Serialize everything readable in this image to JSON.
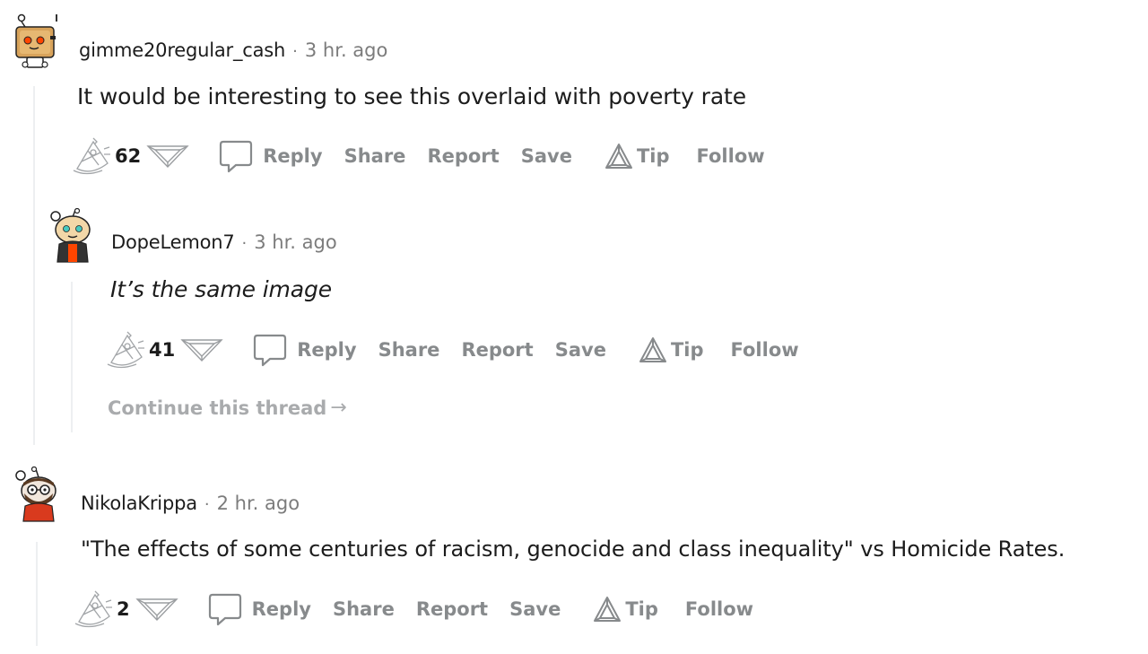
{
  "comments": [
    {
      "username": "gimme20regular_cash",
      "separator": "·",
      "time": "3 hr. ago",
      "body": "It would be interesting to see this overlaid with poverty rate",
      "score": "62",
      "actions": {
        "reply": "Reply",
        "share": "Share",
        "report": "Report",
        "save": "Save",
        "tip": "Tip",
        "follow": "Follow"
      },
      "avatar_icon": "toaster-snoo-avatar"
    },
    {
      "username": "DopeLemon7",
      "separator": "·",
      "time": "3 hr. ago",
      "body": "It’s the same image",
      "score": "41",
      "actions": {
        "reply": "Reply",
        "share": "Share",
        "report": "Report",
        "save": "Save",
        "tip": "Tip",
        "follow": "Follow"
      },
      "continue_label": "Continue this thread",
      "avatar_icon": "snoo-avatar"
    },
    {
      "username": "NikolaKrippa",
      "separator": "·",
      "time": "2 hr. ago",
      "body": "\"The effects of some centuries of racism, genocide and class inequality\" vs Homicide Rates.",
      "score": "2",
      "actions": {
        "reply": "Reply",
        "share": "Share",
        "report": "Report",
        "save": "Save",
        "tip": "Tip",
        "follow": "Follow"
      },
      "avatar_icon": "bearded-snoo-avatar"
    }
  ],
  "colors": {
    "text": "#1c1c1c",
    "muted": "#878a8c",
    "thread_line": "#edeff1",
    "snoo_orange": "#ff4500"
  }
}
